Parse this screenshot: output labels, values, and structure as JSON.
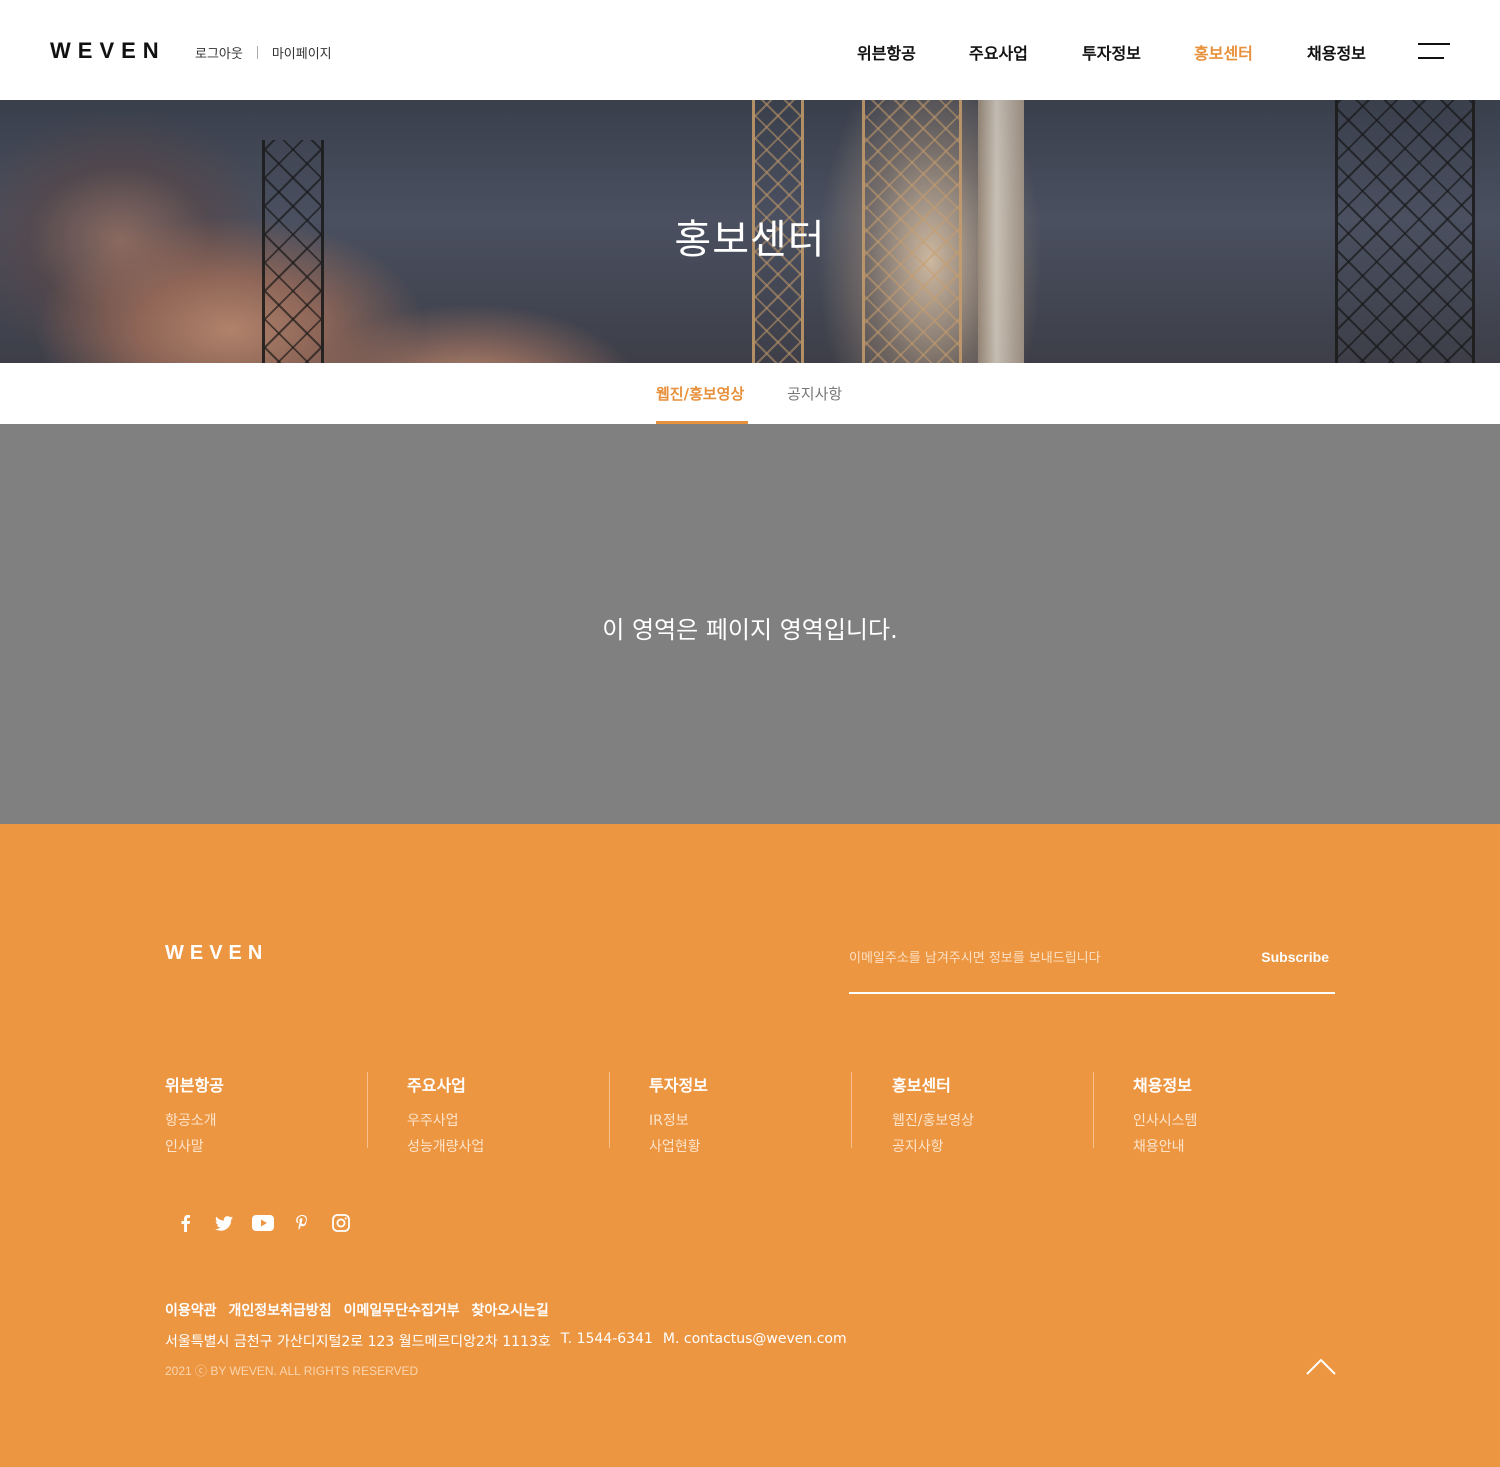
{
  "header": {
    "logo": "WEVEN",
    "util": {
      "logout": "로그아웃",
      "mypage": "마이페이지"
    },
    "nav": [
      {
        "label": "위븐항공",
        "active": false
      },
      {
        "label": "주요사업",
        "active": false
      },
      {
        "label": "투자정보",
        "active": false
      },
      {
        "label": "홍보센터",
        "active": true
      },
      {
        "label": "채용정보",
        "active": false
      }
    ],
    "menu_icon": "hamburger-icon"
  },
  "hero": {
    "title": "홍보센터"
  },
  "tabs": [
    {
      "label": "웹진/홍보영상",
      "active": true
    },
    {
      "label": "공지사항",
      "active": false
    }
  ],
  "content": {
    "message": "이 영역은 페이지 영역입니다."
  },
  "footer": {
    "logo": "WEVEN",
    "subscribe": {
      "placeholder": "이메일주소를 남겨주시면 정보를 보내드립니다",
      "button": "Subscribe"
    },
    "columns": [
      {
        "title": "위븐항공",
        "links": [
          "항공소개",
          "인사말"
        ]
      },
      {
        "title": "주요사업",
        "links": [
          "우주사업",
          "성능개량사업"
        ]
      },
      {
        "title": "투자정보",
        "links": [
          "IR정보",
          "사업현황"
        ]
      },
      {
        "title": "홍보센터",
        "links": [
          "웹진/홍보영상",
          "공지사항"
        ]
      },
      {
        "title": "채용정보",
        "links": [
          "인사시스템",
          "채용안내"
        ]
      }
    ],
    "sns": [
      "facebook-icon",
      "twitter-icon",
      "youtube-icon",
      "pinterest-icon",
      "instagram-icon"
    ],
    "links": [
      "이용약관",
      "개인정보취급방침",
      "이메일무단수집거부",
      "찾아오시는길"
    ],
    "address": "서울특별시 금천구 가산디지털2로 123 월드메르디앙2차 1113호",
    "tel": "T. 1544-6341",
    "email": "M. contactus@weven.com",
    "copyright": "2021 ⓒ BY WEVEN. ALL RIGHTS RESERVED"
  },
  "colors": {
    "accent": "#e8913d",
    "footer_bg": "#ec9642",
    "content_bg": "#808080"
  }
}
